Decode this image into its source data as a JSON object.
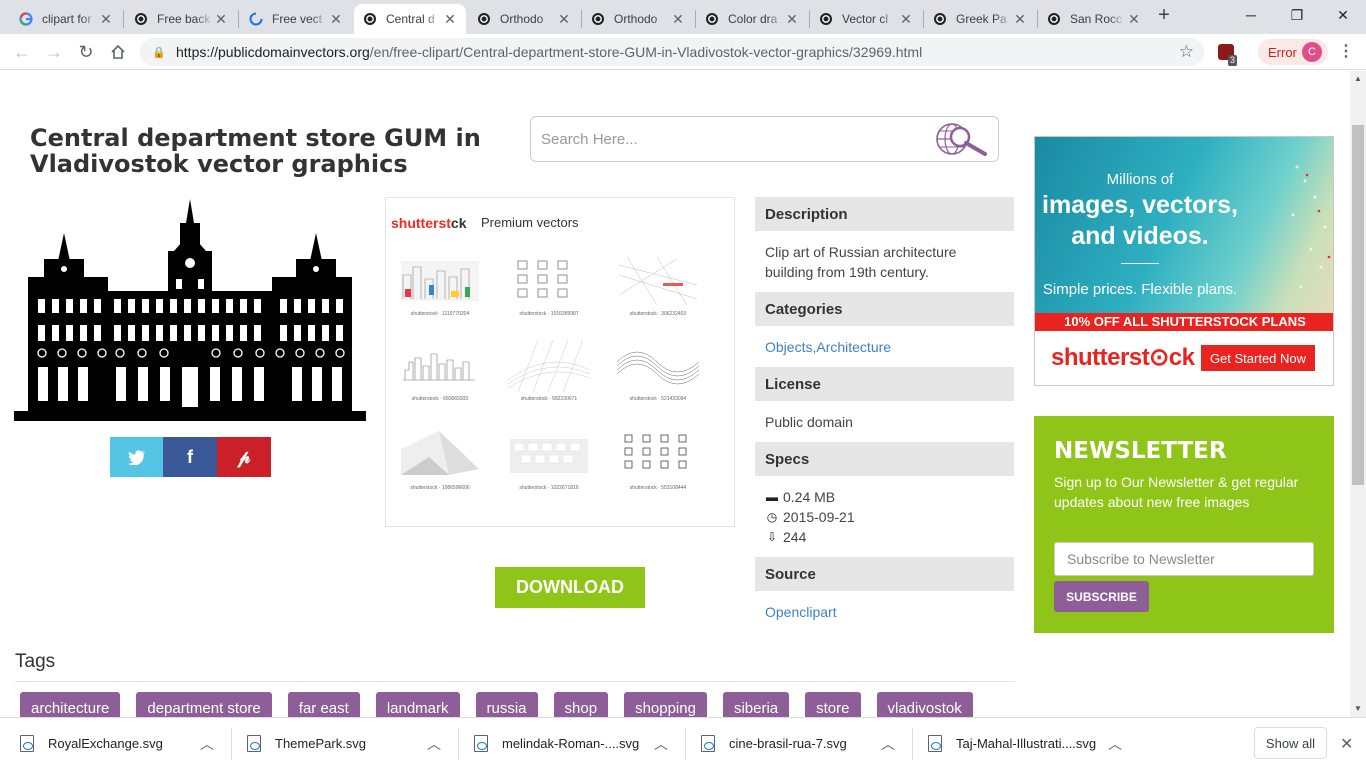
{
  "browser": {
    "tabs": [
      {
        "title": "clipart for",
        "icon": "google-icon"
      },
      {
        "title": "Free back",
        "icon": "pdv-icon"
      },
      {
        "title": "Free vect",
        "icon": "loading-icon"
      },
      {
        "title": "Central d",
        "icon": "pdv-icon",
        "active": true
      },
      {
        "title": "Orthodo",
        "icon": "pdv-icon"
      },
      {
        "title": "Orthodo",
        "icon": "pdv-icon"
      },
      {
        "title": "Color dra",
        "icon": "pdv-icon"
      },
      {
        "title": "Vector cl",
        "icon": "pdv-icon"
      },
      {
        "title": "Greek Pa",
        "icon": "pdv-icon"
      },
      {
        "title": "San Rocc",
        "icon": "pdv-icon"
      }
    ],
    "url_host": "https://publicdomainvectors.org",
    "url_path": "/en/free-clipart/Central-department-store-GUM-in-Vladivostok-vector-graphics/32969.html",
    "extension_badge": "3",
    "error_label": "Error",
    "profile_initial": "C"
  },
  "page": {
    "title": "Central department store GUM in Vladivostok vector graphics",
    "search_placeholder": "Search Here...",
    "social": {
      "twitter": "twitter-icon",
      "facebook": "facebook-icon",
      "pinterest": "pinterest-icon"
    },
    "ad": {
      "brand_part1": "shutterst",
      "brand_part2": "ck",
      "title": "Premium vectors",
      "thumbs": [
        "shutterstock · 1119770204",
        "shutterstock · 1016389987",
        "shutterstock · 306232403",
        "shutterstock · 683665933",
        "shutterstock · 582230671",
        "shutterstock · 521433094",
        "shutterstock · 1086596606",
        "shutterstock · 1022671816",
        "shutterstock · 553108444"
      ]
    },
    "download_label": "DOWNLOAD",
    "info": {
      "description_h": "Description",
      "description": "Clip art of Russian architecture building from 19th century.",
      "categories_h": "Categories",
      "categories": "Objects,Architecture",
      "license_h": "License",
      "license": "Public domain",
      "specs_h": "Specs",
      "size": "0.24 MB",
      "date": "2015-09-21",
      "downloads": "244",
      "source_h": "Source",
      "source": "Openclipart"
    },
    "promo": {
      "line1": "Millions of",
      "line2": "images, vectors, and videos.",
      "line3": "Simple prices. Flexible plans.",
      "offer": "10% OFF ALL SHUTTERSTOCK PLANS",
      "logo": "shutterst⊙ck",
      "cta": "Get Started Now"
    },
    "newsletter": {
      "heading": "NEWSLETTER",
      "text": "Sign up to Our Newsletter & get regular updates about new free images",
      "placeholder": "Subscribe to Newsletter",
      "button": "SUBSCRIBE"
    },
    "tags_heading": "Tags",
    "tags": [
      "architecture",
      "department store",
      "far east",
      "landmark",
      "russia",
      "shop",
      "shopping",
      "siberia",
      "store",
      "vladivostok"
    ]
  },
  "downloads": {
    "files": [
      "RoyalExchange.svg",
      "ThemePark.svg",
      "melindak-Roman-....svg",
      "cine-brasil-rua-7.svg",
      "Taj-Mahal-Illustrati....svg"
    ],
    "show_all": "Show all"
  },
  "colors": {
    "accent_green": "#8ec518",
    "tag_purple": "#8e5e99",
    "link_blue": "#3c83c6",
    "shutterstock_red": "#e92320",
    "twitter": "#55c5e6",
    "facebook": "#3b5998",
    "pinterest": "#cb2027"
  }
}
